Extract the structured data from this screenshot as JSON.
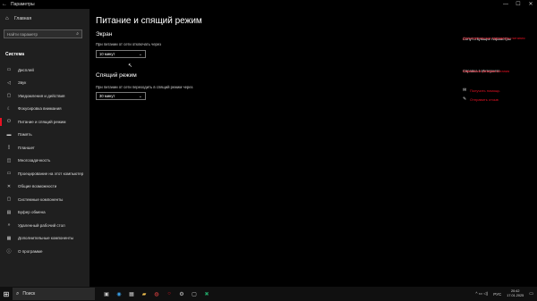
{
  "window": {
    "title": "Параметры",
    "back_icon": "back-arrow-icon",
    "controls": [
      "minimize",
      "maximize",
      "close"
    ]
  },
  "sidebar": {
    "home_label": "Главная",
    "search_placeholder": "Найти параметр",
    "section_title": "Система",
    "items": [
      {
        "label": "Дисплей",
        "icon": "monitor-icon"
      },
      {
        "label": "Звук",
        "icon": "speaker-icon"
      },
      {
        "label": "Уведомления и действия",
        "icon": "notifications-icon"
      },
      {
        "label": "Фокусировка внимания",
        "icon": "moon-icon"
      },
      {
        "label": "Питание и спящий режим",
        "icon": "power-icon",
        "active": true
      },
      {
        "label": "Память",
        "icon": "storage-icon"
      },
      {
        "label": "Планшет",
        "icon": "tablet-icon"
      },
      {
        "label": "Многозадачность",
        "icon": "multitasking-icon"
      },
      {
        "label": "Проецирование на этот компьютер",
        "icon": "projecting-icon"
      },
      {
        "label": "Общие возможности",
        "icon": "shared-experiences-icon"
      },
      {
        "label": "Системные компоненты",
        "icon": "components-icon"
      },
      {
        "label": "Буфер обмена",
        "icon": "clipboard-icon"
      },
      {
        "label": "Удаленный рабочий стол",
        "icon": "remote-desktop-icon"
      },
      {
        "label": "Дополнительные компоненты",
        "icon": "optional-features-icon"
      },
      {
        "label": "О программе",
        "icon": "info-icon"
      }
    ]
  },
  "main": {
    "title": "Питание и спящий режим",
    "screen": {
      "heading": "Экран",
      "label": "При питании от сети отключать через",
      "value": "10 минут"
    },
    "sleep": {
      "heading": "Спящий режим",
      "label": "При питании от сети переходить в спящий режим через",
      "value": "30 минут"
    }
  },
  "related": {
    "title": "Сопутствующие параметры",
    "link": "Дополнительные параметры питания",
    "web_title": "Справка в Интернете",
    "web_link": "Изменение режима питания",
    "get_help": "Получить помощь",
    "feedback": "Отправить отзыв"
  },
  "taskbar": {
    "search_label": "Поиск",
    "time": "20:42",
    "date": "17.01.2025",
    "lang": "РУС",
    "icons": [
      "task-view-icon",
      "edge-icon",
      "store-icon",
      "folder-icon",
      "chrome-icon",
      "opera-icon",
      "settings-icon",
      "app-icon",
      "excel-icon"
    ]
  }
}
